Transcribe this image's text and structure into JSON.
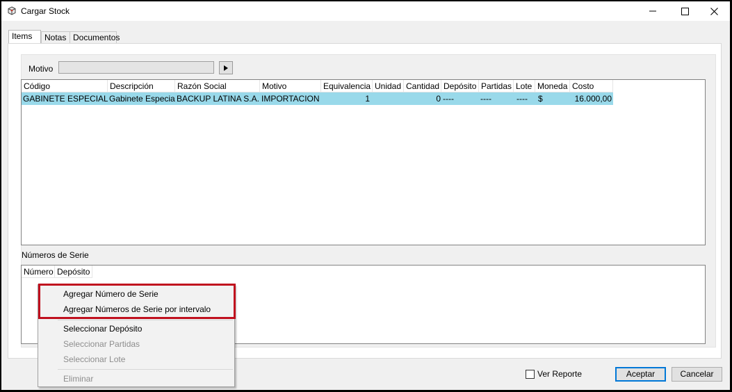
{
  "window": {
    "title": "Cargar Stock",
    "icons": [
      "app-icon",
      "minimize-icon",
      "maximize-icon",
      "close-icon"
    ]
  },
  "tabs": [
    {
      "label": "Items",
      "active": true
    },
    {
      "label": "Notas",
      "active": false
    },
    {
      "label": "Documentos",
      "active": false
    }
  ],
  "motivo": {
    "label": "Motivo",
    "value": ""
  },
  "items_grid": {
    "columns": [
      "Código",
      "Descripción",
      "Razón Social",
      "Motivo",
      "Equivalencia",
      "Unidad",
      "Cantidad",
      "Depósito",
      "Partidas",
      "Lote",
      "Moneda",
      "Costo"
    ],
    "rows": [
      [
        "GABINETE ESPECIAL",
        "Gabinete Especial",
        "BACKUP LATINA S.A.",
        "IMPORTACION",
        "1",
        "",
        "0",
        "----",
        "----",
        "----",
        "$",
        "16.000,00"
      ]
    ],
    "selected_row_color": "#99d9ea"
  },
  "serials": {
    "label": "Números de Serie",
    "columns": [
      "Número",
      "Depósito"
    ]
  },
  "context_menu": {
    "items": [
      {
        "label": "Agregar Número de Serie",
        "enabled": true
      },
      {
        "label": "Agregar Números de Serie por intervalo",
        "enabled": true
      },
      {
        "label": "Seleccionar Depósito",
        "enabled": true
      },
      {
        "label": "Seleccionar Partidas",
        "enabled": false
      },
      {
        "label": "Seleccionar Lote",
        "enabled": false
      },
      {
        "label": "Eliminar",
        "enabled": false
      }
    ],
    "highlight_color": "#c0101e"
  },
  "footer": {
    "ver_reporte_label": "Ver Reporte",
    "ver_reporte_checked": false,
    "accept_label": "Aceptar",
    "cancel_label": "Cancelar",
    "accent_color": "#0078d7"
  }
}
